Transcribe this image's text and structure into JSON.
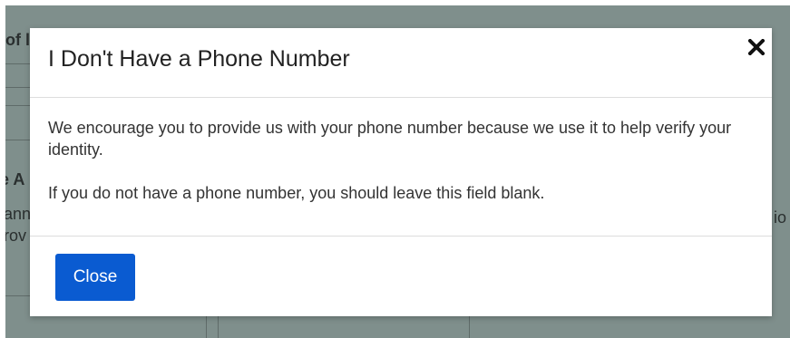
{
  "background": {
    "fragments": {
      "top_left": "of l",
      "heading_left": "e A",
      "line1_left": "ann",
      "line2_left": "rov",
      "right_edge": "io"
    }
  },
  "modal": {
    "title": "I Don't Have a Phone Number",
    "close_icon": "close-icon",
    "body": {
      "paragraph1": "We encourage you to provide us with your phone number because we use it to help verify your identity.",
      "paragraph2": "If you do not have a phone number, you should leave this field blank."
    },
    "footer": {
      "close_label": "Close"
    }
  },
  "colors": {
    "backdrop": "#7f8f8c",
    "primary_button": "#0a5bd1",
    "title_text": "#222222",
    "body_text": "#333333"
  }
}
